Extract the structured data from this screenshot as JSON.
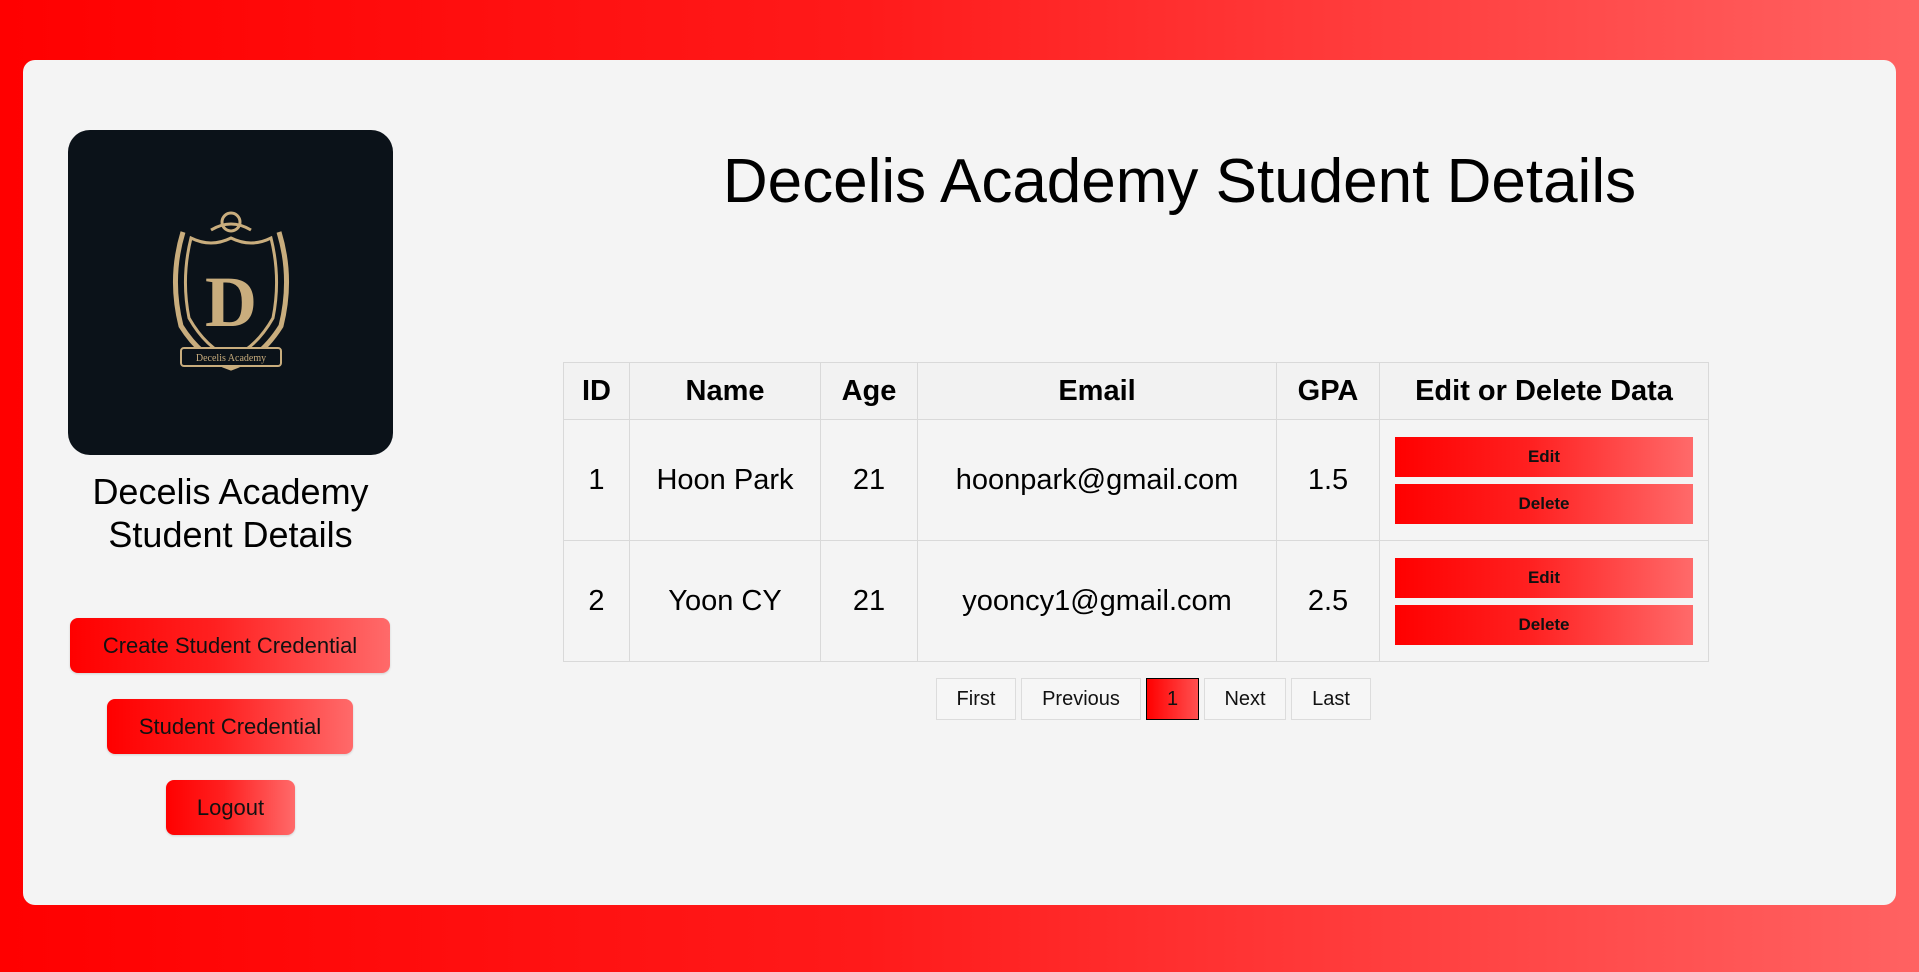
{
  "sidebar": {
    "logo_icon": "academy-crest-icon",
    "logo_text": "Decelis Academy",
    "title_line1": "Decelis Academy",
    "title_line2": "Student Details",
    "buttons": {
      "create": "Create Student Credential",
      "credential": "Student Credential",
      "logout": "Logout"
    }
  },
  "main": {
    "title": "Decelis Academy Student Details",
    "table": {
      "headers": {
        "id": "ID",
        "name": "Name",
        "age": "Age",
        "email": "Email",
        "gpa": "GPA",
        "actions": "Edit or Delete Data"
      },
      "rows": [
        {
          "id": "1",
          "name": "Hoon Park",
          "age": "21",
          "email": "hoonpark@gmail.com",
          "gpa": "1.5",
          "edit": "Edit",
          "delete": "Delete"
        },
        {
          "id": "2",
          "name": "Yoon CY",
          "age": "21",
          "email": "yooncy1@gmail.com",
          "gpa": "2.5",
          "edit": "Edit",
          "delete": "Delete"
        }
      ]
    },
    "pagination": {
      "first": "First",
      "previous": "Previous",
      "current": "1",
      "next": "Next",
      "last": "Last"
    }
  },
  "colors": {
    "accent": "#ff0000",
    "accent_light": "#ff6262",
    "card_bg": "#f4f4f4",
    "logo_bg": "#0b1219",
    "crest_gold": "#c9ad7d"
  }
}
